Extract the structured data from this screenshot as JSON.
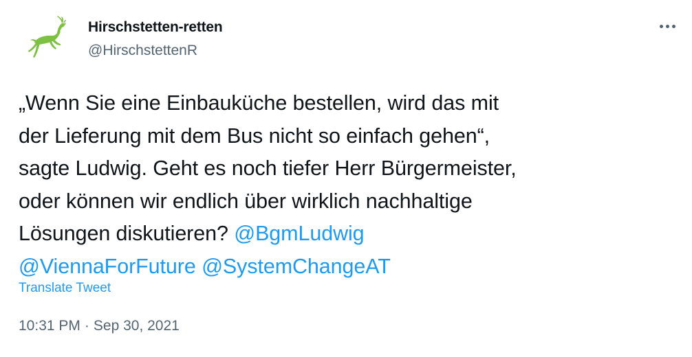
{
  "author": {
    "display_name": "Hirschstetten-retten",
    "handle": "@HirschstettenR",
    "avatar": "leaping-deer-logo",
    "avatar_color": "#7dc142"
  },
  "more_menu": {
    "icon": "more-horizontal-icon"
  },
  "tweet": {
    "lines": [
      {
        "text": "„Wenn Sie eine Einbauküche bestellen, wird das mit"
      },
      {
        "text": "der Lieferung mit dem Bus nicht so einfach gehen“,"
      },
      {
        "text": "sagte Ludwig. Geht es noch tiefer Herr Bürgermeister,"
      },
      {
        "text": "oder können wir endlich über wirklich nachhaltige"
      },
      {
        "text": "Lösungen diskutieren? ",
        "mention": "@BgmLudwig"
      },
      {
        "mention_a": "@ViennaForFuture",
        "mention_b": "@SystemChangeAT"
      }
    ]
  },
  "translate_label": "Translate Tweet",
  "meta": {
    "time": "10:31 PM",
    "separator": "·",
    "date": "Sep 30, 2021"
  },
  "colors": {
    "link": "#1d9bf0",
    "text": "#0f1419",
    "secondary": "#536471"
  }
}
